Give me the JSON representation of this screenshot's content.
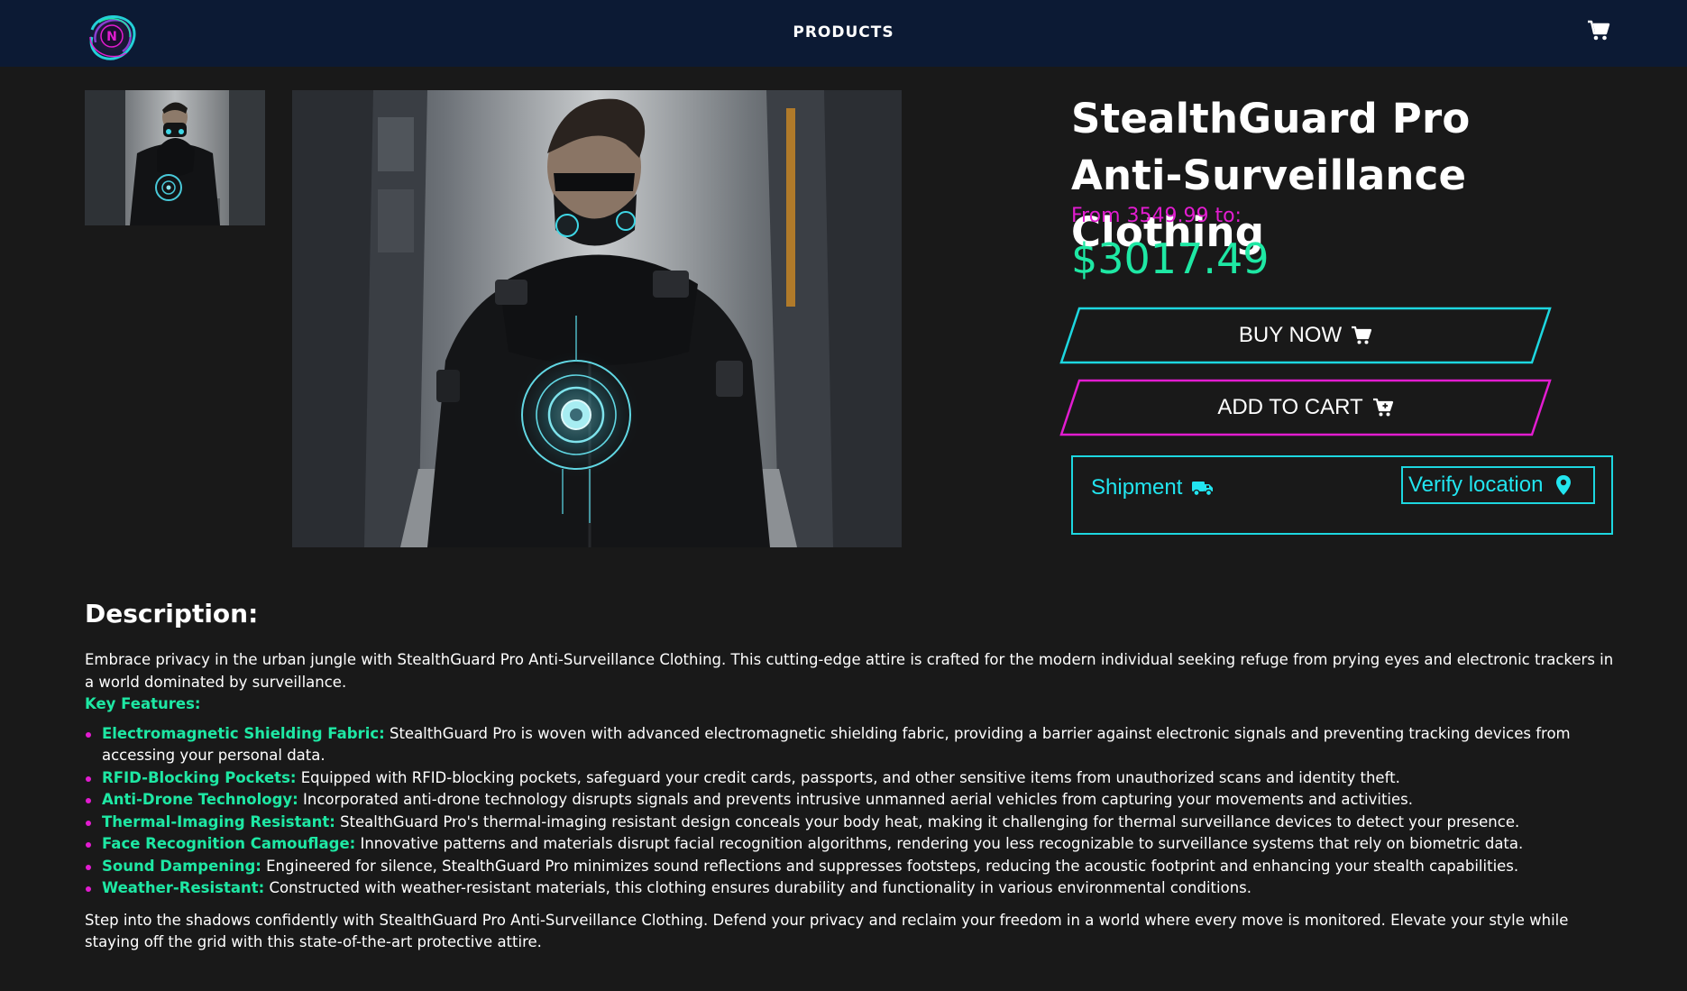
{
  "header": {
    "logo_letter": "N",
    "nav_label": "PRODUCTS",
    "cart_icon": "cart-icon"
  },
  "gallery": {
    "thumbnail_icon": "product-thumbnail",
    "main_icon": "product-photo"
  },
  "product": {
    "title": "StealthGuard Pro Anti-Surveillance Clothing",
    "price_from": "From 3549.99 to:",
    "price": "$3017.49"
  },
  "actions": {
    "buy_now": "BUY NOW",
    "add_to_cart": "ADD TO CART"
  },
  "shipment": {
    "label": "Shipment",
    "verify_label": "Verify location"
  },
  "description": {
    "heading": "Description:",
    "intro": "Embrace privacy in the urban jungle with StealthGuard Pro Anti-Surveillance Clothing. This cutting-edge attire is crafted for the modern individual seeking refuge from prying eyes and electronic trackers in a world dominated by surveillance.",
    "key_features_label": "Key Features:",
    "features": [
      {
        "name": "Electromagnetic Shielding Fabric:",
        "text": " StealthGuard Pro is woven with advanced electromagnetic shielding fabric, providing a barrier against electronic signals and preventing tracking devices from accessing your personal data."
      },
      {
        "name": "RFID-Blocking Pockets:",
        "text": " Equipped with RFID-blocking pockets, safeguard your credit cards, passports, and other sensitive items from unauthorized scans and identity theft."
      },
      {
        "name": "Anti-Drone Technology:",
        "text": " Incorporated anti-drone technology disrupts signals and prevents intrusive unmanned aerial vehicles from capturing your movements and activities."
      },
      {
        "name": "Thermal-Imaging Resistant:",
        "text": " StealthGuard Pro's thermal-imaging resistant design conceals your body heat, making it challenging for thermal surveillance devices to detect your presence."
      },
      {
        "name": "Face Recognition Camouflage:",
        "text": " Innovative patterns and materials disrupt facial recognition algorithms, rendering you less recognizable to surveillance systems that rely on biometric data."
      },
      {
        "name": "Sound Dampening:",
        "text": " Engineered for silence, StealthGuard Pro minimizes sound reflections and suppresses footsteps, reducing the acoustic footprint and enhancing your stealth capabilities."
      },
      {
        "name": "Weather-Resistant:",
        "text": " Constructed with weather-resistant materials, this clothing ensures durability and functionality in various environmental conditions."
      }
    ],
    "closing": "Step into the shadows confidently with StealthGuard Pro Anti-Surveillance Clothing. Defend your privacy and reclaim your freedom in a world where every move is monitored. Elevate your style while staying off the grid with this state-of-the-art protective attire."
  },
  "colors": {
    "header_bg": "#0c1a34",
    "page_bg": "#191919",
    "accent_green": "#1ee8a4",
    "accent_magenta": "#e21cd0",
    "accent_cyan": "#1dd7e0"
  }
}
